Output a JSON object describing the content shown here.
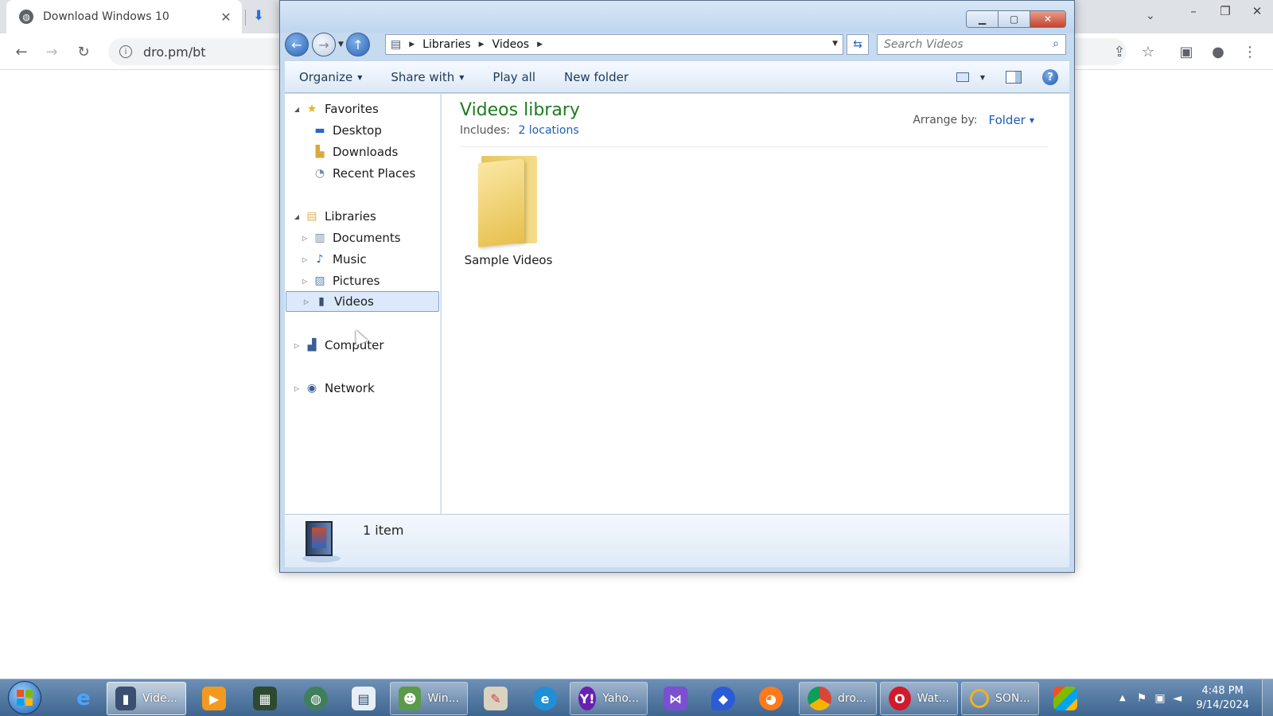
{
  "browser": {
    "tab_title": "Download Windows 10",
    "url": "dro.pm/bt"
  },
  "explorer": {
    "breadcrumb": [
      "Libraries",
      "Videos"
    ],
    "search_placeholder": "Search Videos",
    "commands": {
      "organize": "Organize",
      "share_with": "Share with",
      "play_all": "Play all",
      "new_folder": "New folder"
    },
    "nav": {
      "favorites": "Favorites",
      "desktop": "Desktop",
      "downloads": "Downloads",
      "recent_places": "Recent Places",
      "libraries": "Libraries",
      "documents": "Documents",
      "music": "Music",
      "pictures": "Pictures",
      "videos": "Videos",
      "computer": "Computer",
      "network": "Network"
    },
    "library": {
      "title": "Videos library",
      "includes_label": "Includes:",
      "includes_link": "2 locations",
      "arrange_label": "Arrange by:",
      "arrange_value": "Folder"
    },
    "items": [
      {
        "name": "Sample Videos",
        "icon": "folder-icon"
      }
    ],
    "status": "1 item"
  },
  "taskbar": {
    "items": [
      {
        "label": "Vide...",
        "icon": "explorer-icon"
      },
      {
        "label": "Win...",
        "icon": "users-icon"
      },
      {
        "label": "Yaho...",
        "icon": "yahoo-icon"
      },
      {
        "label": "dro...",
        "icon": "chrome-icon"
      },
      {
        "label": "Wat...",
        "icon": "opera-icon"
      },
      {
        "label": "SON...",
        "icon": "ring-icon"
      }
    ],
    "time": "4:48 PM",
    "date": "9/14/2024"
  },
  "colors": {
    "library_title": "#1e7b21",
    "link": "#1a5fb4",
    "taskbar": "#4f7399"
  }
}
